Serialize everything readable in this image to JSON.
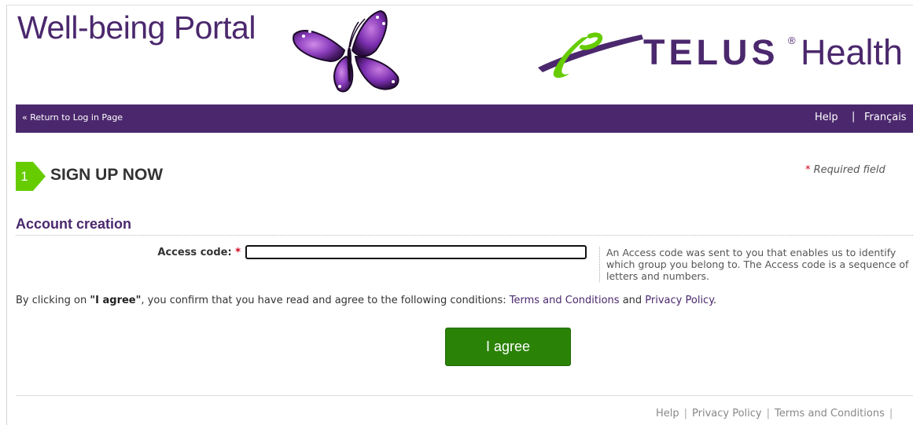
{
  "header": {
    "site_title": "Well-being Portal",
    "brand_word": "TELUS",
    "brand_reg": "®",
    "brand_suffix": "Health"
  },
  "navbar": {
    "return_link": "« Return to Log in Page",
    "help_link": "Help",
    "separator": "|",
    "language_link": "Français"
  },
  "step": {
    "number": "1",
    "title": "SIGN UP NOW"
  },
  "required_note": {
    "star": "*",
    "text": "Required field"
  },
  "section": {
    "title": "Account creation"
  },
  "access_code": {
    "label": "Access code:",
    "star": "*",
    "value": "",
    "help": "An Access code was sent to you that enables us to identify which group you belong to. The Access code is a sequence of letters and numbers."
  },
  "consent": {
    "prefix": "By clicking on ",
    "bold": "\"I agree\"",
    "middle": ", you confirm that you have read and agree to the following conditions: ",
    "terms_link": "Terms and Conditions",
    "and": " and ",
    "privacy_link": "Privacy Policy",
    "suffix": "."
  },
  "agree_button": "I agree",
  "footer": {
    "help": "Help",
    "privacy": "Privacy Policy",
    "terms": "Terms and Conditions",
    "separator": "|"
  },
  "colors": {
    "brand_purple": "#4b286d",
    "brand_green": "#2a8207",
    "step_green": "#66cc00",
    "required_red": "#d0021b"
  }
}
